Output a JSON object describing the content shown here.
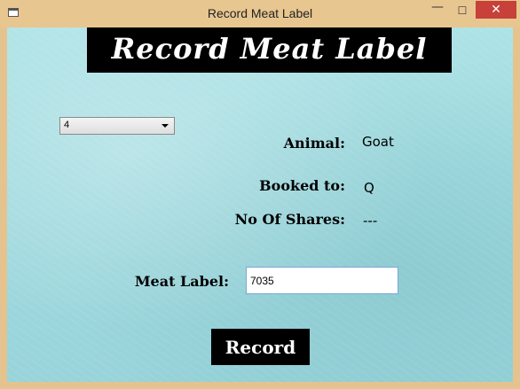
{
  "window": {
    "title": "Record Meat Label",
    "minimize_glyph": "—",
    "maximize_glyph": "☐",
    "close_glyph": "✕"
  },
  "header": {
    "banner": "Record Meat Label"
  },
  "selector": {
    "selected_value": "4"
  },
  "details": {
    "animal_label": "Animal:",
    "animal_value": "Goat",
    "booked_label": "Booked to:",
    "booked_value": "Q",
    "shares_label": "No Of Shares:",
    "shares_value": "---"
  },
  "meat_label": {
    "label": "Meat Label:",
    "value": "7035"
  },
  "actions": {
    "record_label": "Record"
  },
  "colors": {
    "frame": "#e5c38f",
    "close_button": "#c7403a",
    "background": "#a3dde1",
    "banner": "#000000"
  }
}
